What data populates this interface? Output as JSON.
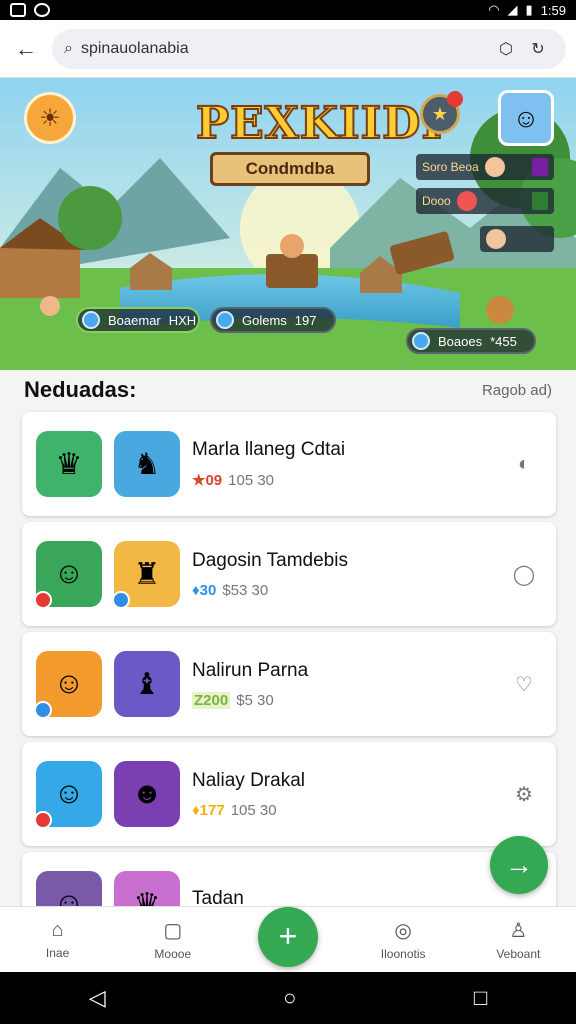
{
  "status_bar": {
    "time": "1:59"
  },
  "search": {
    "query": "spinauolanabia"
  },
  "banner": {
    "title": "PEXKIIDI",
    "subtitle": "Condmdba",
    "pills": [
      {
        "label": "Boaemar",
        "value": "HXH"
      },
      {
        "label": "Golems",
        "value": "197"
      },
      {
        "label": "Boaoes",
        "value": "*455"
      }
    ],
    "leaderboard": [
      {
        "label": "Soro Beoa"
      },
      {
        "label": "Dooo"
      },
      {
        "label": ""
      }
    ]
  },
  "section": {
    "title": "Neduadas:",
    "link": "Ragob ad)"
  },
  "apps": [
    {
      "title": "Marla llaneg Cdtai",
      "rating": "★09",
      "meta": "105 30",
      "rating_color": "#d9472b"
    },
    {
      "title": "Dagosin Tamdebis",
      "rating": "♦30",
      "meta": "$53 30",
      "rating_color": "#2f8fe5"
    },
    {
      "title": "Nalirun Parna",
      "rating": "Z200",
      "meta": "$5 30",
      "rating_color": "#7cb342"
    },
    {
      "title": "Naliay Drakal",
      "rating": "♦177",
      "meta": "105 30",
      "rating_color": "#f2b10e"
    },
    {
      "title": "Tadan",
      "rating": "",
      "meta": "",
      "rating_color": "#777777"
    }
  ],
  "bottom_nav": [
    {
      "label": "Inae",
      "icon": "home-icon"
    },
    {
      "label": "Moooe",
      "icon": "chat-icon"
    },
    {
      "label": "+",
      "icon": "plus-icon"
    },
    {
      "label": "Iloonotis",
      "icon": "compass-icon"
    },
    {
      "label": "Veboant",
      "icon": "person-icon"
    }
  ],
  "colors": {
    "accent": "#34a853",
    "banner_title": "#ffcc33"
  }
}
